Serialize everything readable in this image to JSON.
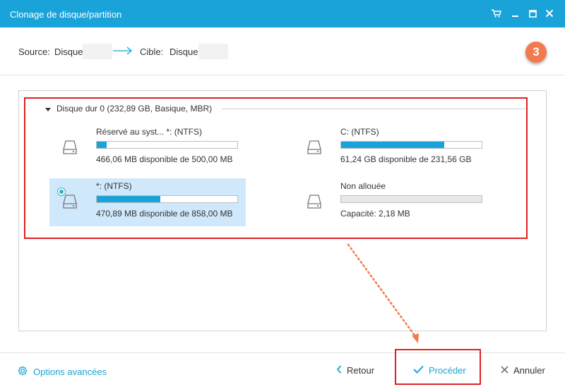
{
  "window": {
    "title": "Clonage de disque/partition"
  },
  "header": {
    "source_label": "Source:",
    "source_value": "Disque",
    "target_label": "Cible:",
    "target_value": "Disque",
    "step_number": "3"
  },
  "disk": {
    "title": "Disque dur 0 (232,89 GB, Basique, MBR)",
    "partitions": [
      {
        "name": "Réservé au syst... *: (NTFS)",
        "info": "466,06 MB disponible de 500,00 MB",
        "used_fraction": 0.068,
        "selected": false
      },
      {
        "name": "C: (NTFS)",
        "info": "61,24 GB disponible de 231,56 GB",
        "used_fraction": 0.736,
        "selected": false
      },
      {
        "name": "*: (NTFS)",
        "info": "470,89 MB disponible de 858,00 MB",
        "used_fraction": 0.45,
        "selected": true
      },
      {
        "name": "Non allouée",
        "info": "Capacité: 2,18 MB",
        "used_fraction": 0,
        "selected": false
      }
    ]
  },
  "footer": {
    "advanced_label": "Options avancées",
    "back_label": "Retour",
    "proceed_label": "Procéder",
    "cancel_label": "Annuler"
  },
  "colors": {
    "accent": "#1aa3d8",
    "highlight_box": "#e02020",
    "step_badge": "#f27a4e",
    "selected_bg": "#cfe8fb"
  }
}
